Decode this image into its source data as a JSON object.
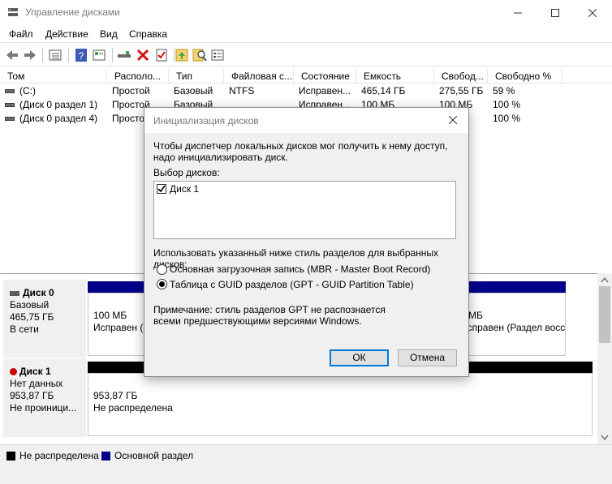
{
  "window": {
    "title": "Управление дисками"
  },
  "menu": [
    "Файл",
    "Действие",
    "Вид",
    "Справка"
  ],
  "toolbar": {
    "icons": [
      "back-icon",
      "forward-icon",
      "list-view-icon",
      "help-icon",
      "properties-icon",
      "connect-icon",
      "delete-icon",
      "check-icon",
      "new-volume-icon",
      "search-icon",
      "settings-icon"
    ]
  },
  "volumes": {
    "headers": [
      "Том",
      "Располо...",
      "Тип",
      "Файловая с...",
      "Состояние",
      "Емкость",
      "Свобод...",
      "Свободно %"
    ],
    "rows": [
      [
        "(C:)",
        "Простой",
        "Базовый",
        "NTFS",
        "Исправен...",
        "465,14 ГБ",
        "275,55 ГБ",
        "59 %"
      ],
      [
        "(Диск 0 раздел 1)",
        "Простой",
        "Базовый",
        "",
        "Исправен...",
        "100 МБ",
        "100 МБ",
        "100 %"
      ],
      [
        "(Диск 0 раздел 4)",
        "Просто",
        "",
        "",
        "",
        "",
        "",
        "100 %"
      ]
    ]
  },
  "disks": [
    {
      "name": "Диск 0",
      "type": "Базовый",
      "size": "465,75 ГБ",
      "status": "В сети",
      "part_left_size": "100 МБ",
      "part_left_status": "Исправен (",
      "part_right_size": "МБ",
      "part_right_status": "Исправен (Раздел восстан"
    },
    {
      "name": "Диск 1",
      "type": "Нет данных",
      "size": "953,87 ГБ",
      "status": "Не проиници...",
      "part_size": "953,87 ГБ",
      "part_status": "Не распределена"
    }
  ],
  "legend": {
    "unallocated": "Не распределена",
    "primary": "Основной раздел"
  },
  "colors": {
    "unallocated": "#000000",
    "primary": "#00008b",
    "accent": "#0078d7"
  },
  "dialog": {
    "title": "Инициализация дисков",
    "intro": "Чтобы диспетчер локальных дисков мог получить к нему доступ, надо инициализировать диск.",
    "select_label": "Выбор дисков:",
    "disk_item": "Диск 1",
    "disk_checked": true,
    "style_label": "Использовать указанный ниже стиль разделов для выбранных дисков:",
    "option_mbr": "Основная загрузочная запись (MBR - Master Boot Record)",
    "option_gpt": "Таблица с GUID разделов (GPT - GUID Partition Table)",
    "selected_option": "gpt",
    "note": "Примечание: стиль разделов GPT не распознается всеми предшествующими версиями Windows.",
    "ok": "ОК",
    "cancel": "Отмена"
  }
}
